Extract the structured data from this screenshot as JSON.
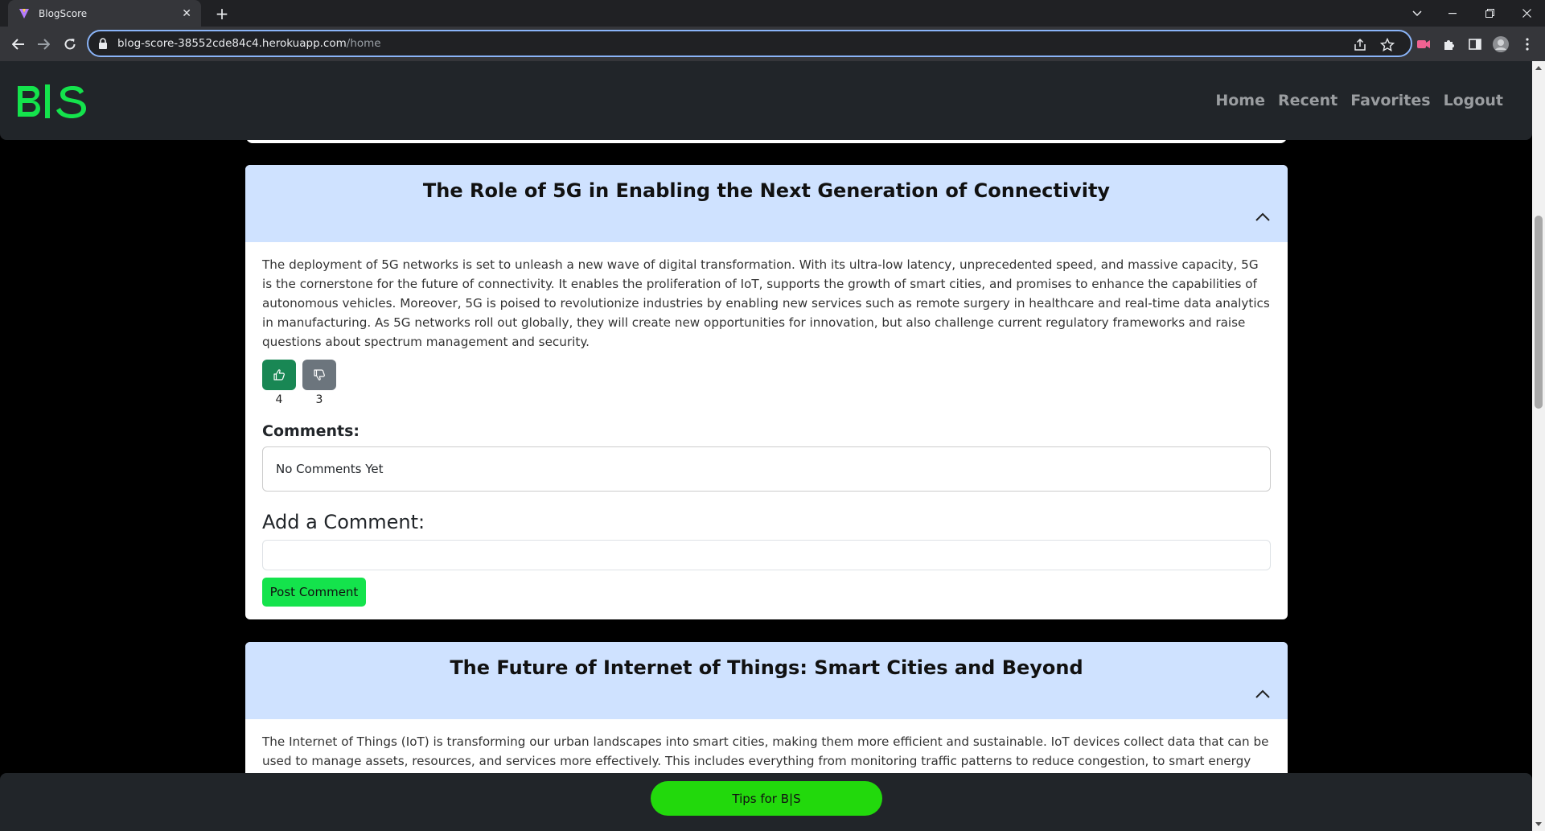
{
  "browser": {
    "tab_title": "BlogScore",
    "new_tab": "+",
    "url_host": "blog-score-38552cde84c4.herokuapp.com",
    "url_path": "/home"
  },
  "site": {
    "brand": "B|S",
    "nav": [
      "Home",
      "Recent",
      "Favorites",
      "Logout"
    ]
  },
  "posts": [
    {
      "title": "The Role of 5G in Enabling the Next Generation of Connectivity",
      "body": "The deployment of 5G networks is set to unleash a new wave of digital transformation. With its ultra-low latency, unprecedented speed, and massive capacity, 5G is the cornerstone for the future of connectivity. It enables the proliferation of IoT, supports the growth of smart cities, and promises to enhance the capabilities of autonomous vehicles. Moreover, 5G is poised to revolutionize industries by enabling new services such as remote surgery in healthcare and real-time data analytics in manufacturing. As 5G networks roll out globally, they will create new opportunities for innovation, but also challenge current regulatory frameworks and raise questions about spectrum management and security.",
      "likes": "4",
      "dislikes": "3",
      "comments_label": "Comments:",
      "no_comments": "No Comments Yet",
      "add_comment_label": "Add a Comment:",
      "comment_input_value": "",
      "post_comment_label": "Post Comment"
    },
    {
      "title": "The Future of Internet of Things: Smart Cities and Beyond",
      "body": "The Internet of Things (IoT) is transforming our urban landscapes into smart cities, making them more efficient and sustainable. IoT devices collect data that can be used to manage assets, resources, and services more effectively. This includes everything from monitoring traffic patterns to reduce congestion, to smart energy grids that optimize"
    }
  ],
  "footer": {
    "tips_label": "Tips for B|S"
  },
  "colors": {
    "brand_green": "#14e34c",
    "card_header": "#cfe2ff",
    "like_button": "#198754",
    "dislike_button": "#6c757d",
    "tips_button": "#22d90c"
  }
}
